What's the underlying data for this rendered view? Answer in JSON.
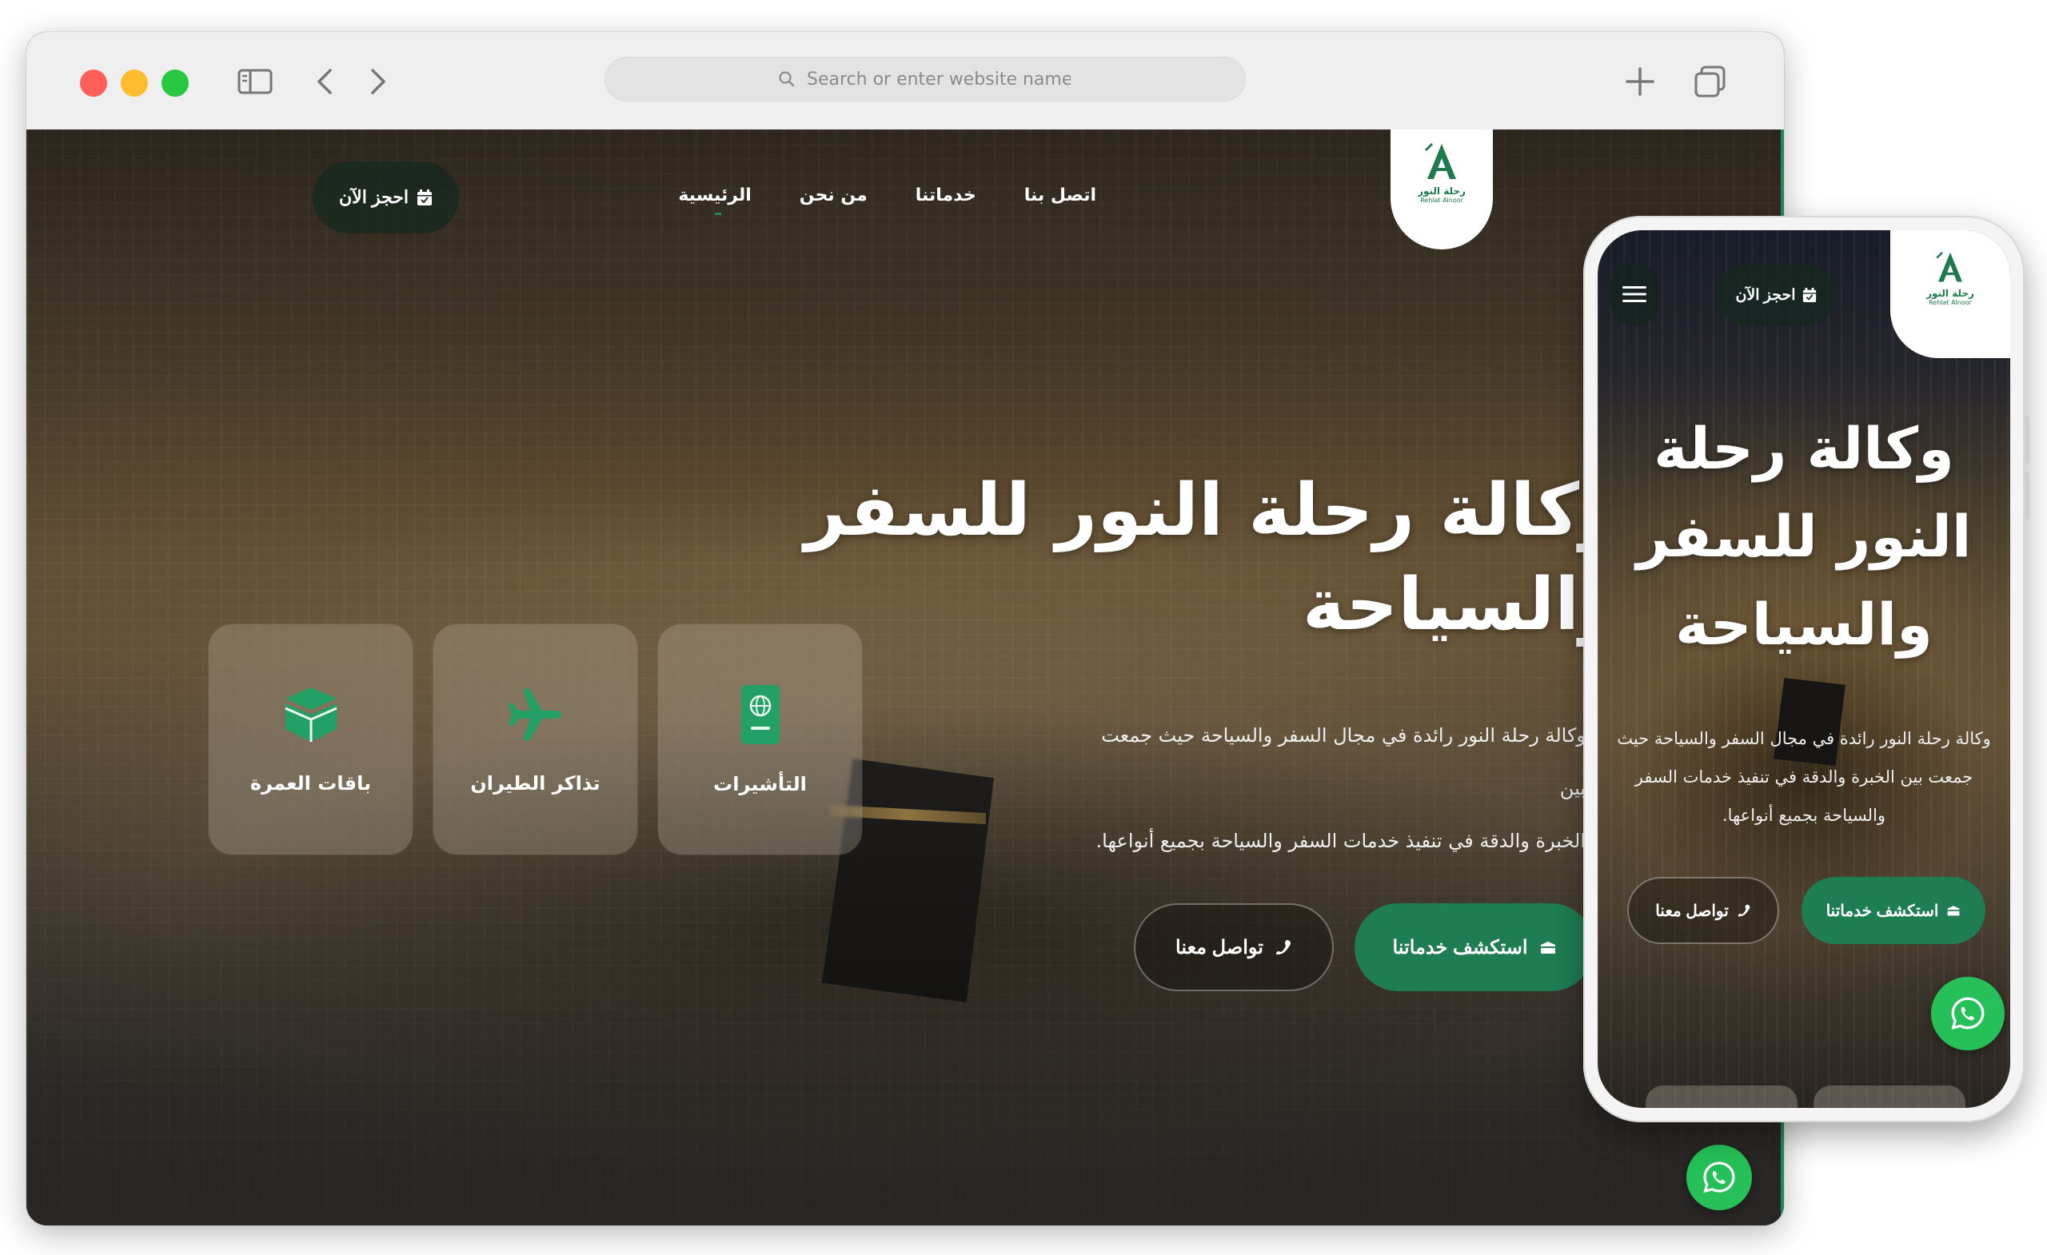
{
  "browser": {
    "address_placeholder": "Search or enter website name",
    "icons": [
      "sidebar-icon",
      "chevron-left-icon",
      "chevron-right-icon",
      "search-icon",
      "plus-icon",
      "tabs-icon"
    ]
  },
  "site": {
    "nav": [
      {
        "label": "الرئيسية",
        "active": true
      },
      {
        "label": "من نحن"
      },
      {
        "label": "خدماتنا"
      },
      {
        "label": "اتصل بنا"
      }
    ],
    "book_button": "احجز الآن",
    "logo": {
      "text": "رحلة النور",
      "sub": "Rehlat Alnoor"
    },
    "hero": {
      "title": "وكالة رحلة النور للسفر والسياحة",
      "description": "وكالة رحلة النور رائدة في مجال السفر والسياحة حيث جمعت بين\nالخبرة والدقة في تنفيذ خدمات السفر والسياحة بجميع أنواعها.",
      "explore_button": "استكشف خدماتنا",
      "contact_button": "تواصل معنا"
    },
    "services": [
      {
        "label": "التأشيرات",
        "icon": "passport-icon"
      },
      {
        "label": "تذاكر الطيران",
        "icon": "airplane-icon"
      },
      {
        "label": "باقات العمرة",
        "icon": "kaaba-icon"
      }
    ]
  },
  "mobile": {
    "title": "وكالة رحلة النور للسفر والسياحة",
    "description": "وكالة رحلة النور رائدة في مجال السفر والسياحة حيث\nجمعت بين الخبرة والدقة في تنفيذ خدمات السفر\nوالسياحة بجميع أنواعها."
  },
  "colors": {
    "brand_green": "#1e7d52",
    "whatsapp_green": "#25c057",
    "chrome_bg": "#efefef",
    "traffic_red": "#ff5f57",
    "traffic_yellow": "#febc2e",
    "traffic_green": "#28c840"
  }
}
